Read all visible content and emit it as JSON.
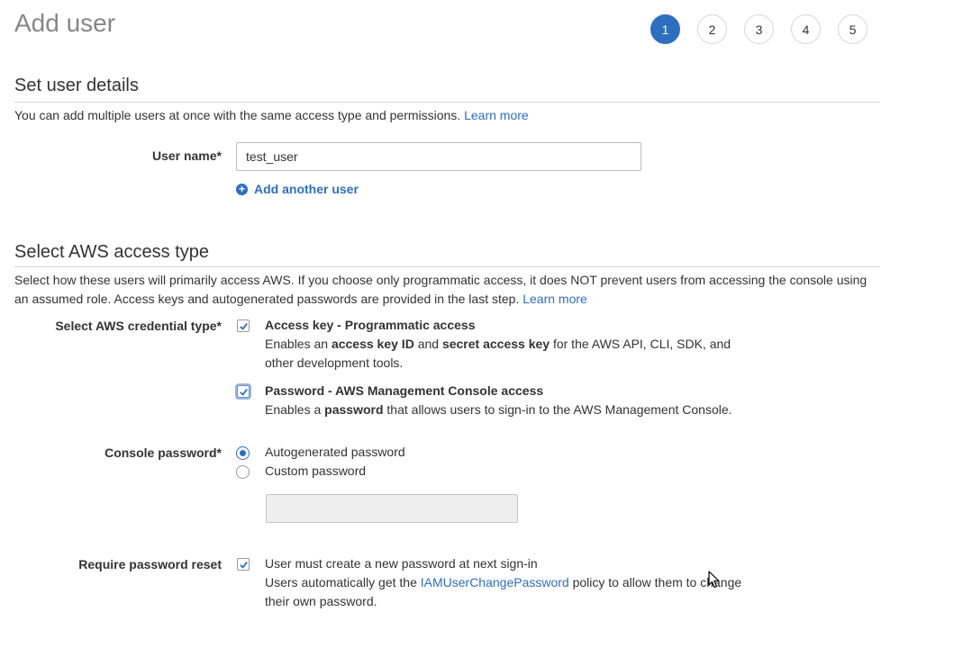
{
  "header": {
    "title": "Add user"
  },
  "steps": [
    "1",
    "2",
    "3",
    "4",
    "5"
  ],
  "details": {
    "title": "Set user details",
    "description": "You can add multiple users at once with the same access type and permissions.",
    "learn_more": "Learn more",
    "user_name_label": "User name*",
    "user_name_value": "test_user",
    "add_another": "Add another user"
  },
  "access": {
    "title": "Select AWS access type",
    "description": "Select how these users will primarily access AWS. If you choose only programmatic access, it does NOT prevent users from accessing the console using an assumed role. Access keys and autogenerated passwords are provided in the last step.",
    "learn_more": "Learn more",
    "credential_label": "Select AWS credential type*",
    "programmatic": {
      "title": "Access key - Programmatic access",
      "desc_1": "Enables an ",
      "desc_b1": "access key ID",
      "desc_2": " and ",
      "desc_b2": "secret access key",
      "desc_3": " for the AWS API, CLI, SDK, and",
      "desc_4": "other development tools.",
      "checked": true
    },
    "console": {
      "title": "Password - AWS Management Console access",
      "desc_1": "Enables a ",
      "desc_b1": "password",
      "desc_2": " that allows users to sign-in to the AWS Management Console.",
      "checked": true
    },
    "password_label": "Console password*",
    "autogen": "Autogenerated password",
    "custom": "Custom password",
    "reset_label": "Require password reset",
    "reset_text": "User must create a new password at next sign-in",
    "reset_desc_1": "Users automatically get the ",
    "reset_link": "IAMUserChangePassword",
    "reset_desc_2": " policy to allow them to change",
    "reset_desc_3": "their own password."
  },
  "colors": {
    "accent": "#2e6ebf",
    "rule": "#d5d5d5",
    "title_gray": "#878787"
  }
}
